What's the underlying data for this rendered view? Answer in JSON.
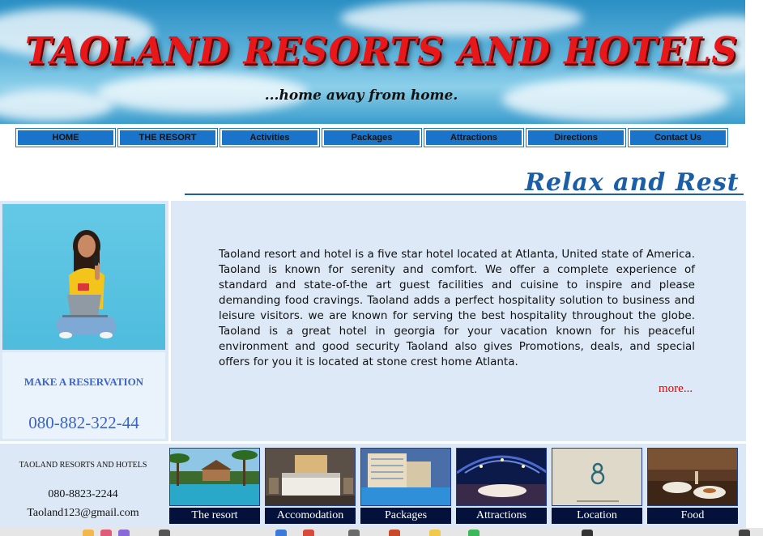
{
  "banner": {
    "title": "TAOLAND  RESORTS AND HOTELS",
    "tagline": "...home away from home."
  },
  "nav": {
    "items": [
      {
        "label": "HOME"
      },
      {
        "label": "THE RESORT"
      },
      {
        "label": "Activities"
      },
      {
        "label": "Packages"
      },
      {
        "label": "Attractions"
      },
      {
        "label": "Directions"
      },
      {
        "label": "Contact Us"
      }
    ]
  },
  "heading": "Relax and Rest",
  "sidebar": {
    "reservation_label": "MAKE A RESERVATION",
    "phone": "080-882-322-44"
  },
  "main": {
    "description": "Taoland resort and hotel is a five star hotel located at Atlanta, United state of America. Taoland is known for serenity and comfort. We offer a complete experience of standard and state-of-the art guest facilities and cuisine to inspire and please demanding food cravings. Taoland adds a perfect hospitality solution to business and leisure visitors. we are known for serving the best hospitality throughout the globe. Taoland is a great hotel in georgia for your vacation known for his peaceful environment and good security Taoland also gives Promotions, deals, and special offers for you it is located at stone crest home Atlanta.",
    "more_link": "more..."
  },
  "footer": {
    "name": "TAOLAND RESORTS AND HOTELS",
    "phone": "080-8823-2244",
    "email": "Taoland123@gmail.com",
    "thumbnails": [
      {
        "caption": "The resort"
      },
      {
        "caption": "Accomodation"
      },
      {
        "caption": "Packages"
      },
      {
        "caption": "Attractions"
      },
      {
        "caption": "Location"
      },
      {
        "caption": "Food"
      }
    ]
  },
  "colors": {
    "nav_bg": "#1a74c9",
    "title_red": "#e8181a",
    "heading_blue": "#1b5ea8",
    "link_red": "#e00000",
    "caption_bg": "#04113a"
  }
}
